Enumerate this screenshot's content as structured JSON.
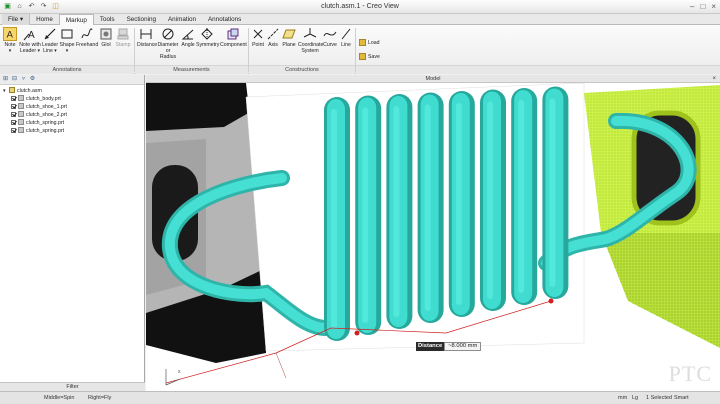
{
  "window": {
    "title": "clutch.asm.1 - Creo View"
  },
  "tabs": [
    "Home",
    "Markup",
    "Tools",
    "Sectioning",
    "Animation",
    "Annotations"
  ],
  "file_tab": "File ▾",
  "active_tab": "Markup",
  "ribbon": {
    "annotations": [
      {
        "id": "note",
        "label": "Note",
        "label2": "▾"
      },
      {
        "id": "note-with-leader",
        "label": "Note with",
        "label2": "Leader ▾"
      },
      {
        "id": "leader-line",
        "label": "Leader",
        "label2": "Line ▾"
      },
      {
        "id": "shape",
        "label": "Shape",
        "label2": "▾"
      },
      {
        "id": "freehand",
        "label": "Freehand",
        "label2": ""
      },
      {
        "id": "glol",
        "label": "Glol",
        "label2": ""
      },
      {
        "id": "stamp",
        "label": "Stamp",
        "label2": ""
      }
    ],
    "measurements": [
      {
        "id": "distance",
        "label": "Distance",
        "label2": ""
      },
      {
        "id": "diameter",
        "label": "Diameter",
        "label2": "or Radius"
      },
      {
        "id": "angle",
        "label": "Angle",
        "label2": ""
      },
      {
        "id": "symmetry",
        "label": "Symmetry",
        "label2": ""
      },
      {
        "id": "component",
        "label": "Component",
        "label2": ""
      }
    ],
    "constructions": [
      {
        "id": "point",
        "label": "Point",
        "label2": ""
      },
      {
        "id": "axis",
        "label": "Axis",
        "label2": ""
      },
      {
        "id": "plane",
        "label": "Plane",
        "label2": ""
      },
      {
        "id": "coordinate-system",
        "label": "Coordinate",
        "label2": "System"
      },
      {
        "id": "curve",
        "label": "Curve",
        "label2": ""
      },
      {
        "id": "line",
        "label": "Line",
        "label2": ""
      }
    ],
    "load_label": "Load",
    "save_label": "Save",
    "groups": {
      "annotations": "Annotations",
      "measurements": "Measurements",
      "constructions": "Constructions"
    }
  },
  "tree": {
    "root": "clutch.asm",
    "items": [
      "clutch_body.prt",
      "clutch_shoe_1.prt",
      "clutch_shoe_2.prt",
      "clutch_spring.prt",
      "clutch_spring.prt"
    ]
  },
  "filter_label": "Filter",
  "viewport_title": "Model",
  "measurement": {
    "key": "Distance",
    "value": "~8.000 mm"
  },
  "watermark": "PTC",
  "status": {
    "left1": "Middle=Spin",
    "left2": "Right=Fly",
    "units": "mm",
    "length": "Lg",
    "selected": "1 Selected",
    "mode": "Smart"
  },
  "colors": {
    "spring": "#40dcd0",
    "housing_green": "#ccf24a",
    "housing_black": "#111111",
    "housing_gray": "#b5b5b5",
    "selection_tab": "#f7d66b",
    "measure_line": "#d02020"
  }
}
